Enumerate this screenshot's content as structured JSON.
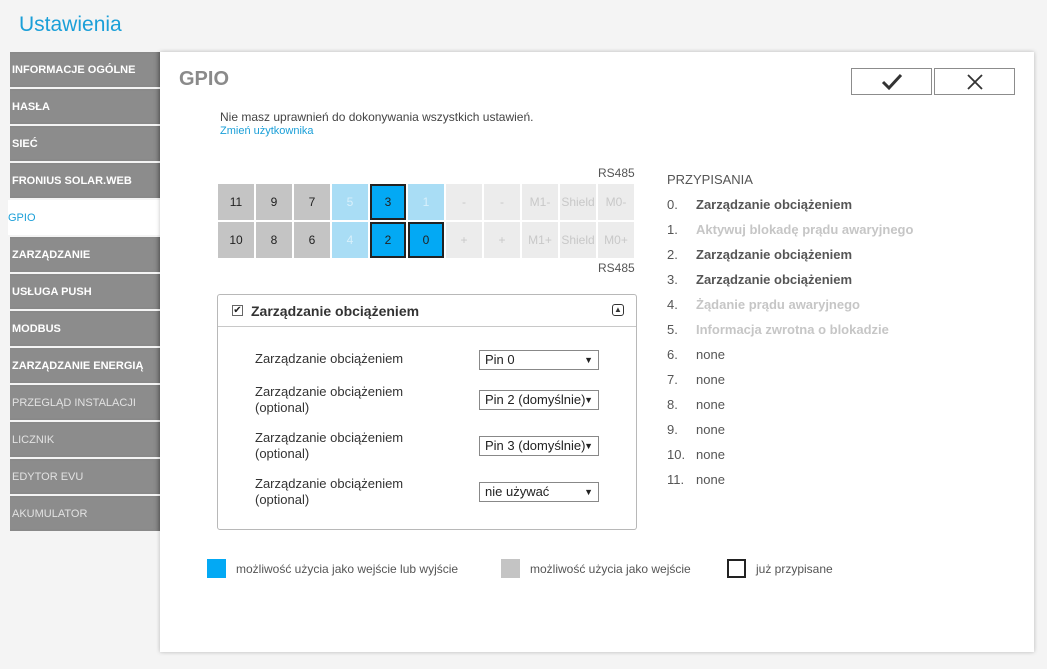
{
  "app_title": "Ustawienia",
  "sidebar": {
    "items": [
      {
        "label": "INFORMACJE OGÓLNE"
      },
      {
        "label": "HASŁA"
      },
      {
        "label": "SIEĆ"
      },
      {
        "label": "FRONIUS SOLAR.WEB"
      },
      {
        "label": "GPIO"
      },
      {
        "label": "ZARZĄDZANIE"
      },
      {
        "label": "USŁUGA PUSH"
      },
      {
        "label": "MODBUS"
      },
      {
        "label": "ZARZĄDZANIE ENERGIĄ"
      },
      {
        "label": "PRZEGLĄD INSTALACJI"
      },
      {
        "label": "LICZNIK"
      },
      {
        "label": "EDYTOR EVU"
      },
      {
        "label": "AKUMULATOR"
      }
    ]
  },
  "panel": {
    "title": "GPIO",
    "notice": "Nie masz uprawnień do dokonywania wszystkich ustawień.",
    "change_user_link": "Zmień użytkownika",
    "rs485_top": "RS485",
    "rs485_bottom": "RS485"
  },
  "pins": {
    "top_row": [
      {
        "label": "11",
        "state": "gray"
      },
      {
        "label": "9",
        "state": "gray"
      },
      {
        "label": "7",
        "state": "gray"
      },
      {
        "label": "5",
        "state": "lightblue"
      },
      {
        "label": "3",
        "state": "blue"
      },
      {
        "label": "1",
        "state": "lightblue"
      },
      {
        "label": "-",
        "state": "disabled"
      },
      {
        "label": "-",
        "state": "disabled"
      },
      {
        "label": "M1-",
        "state": "disabled"
      },
      {
        "label": "Shield",
        "state": "disabled"
      },
      {
        "label": "M0-",
        "state": "disabled"
      }
    ],
    "bottom_row": [
      {
        "label": "10",
        "state": "gray"
      },
      {
        "label": "8",
        "state": "gray"
      },
      {
        "label": "6",
        "state": "gray"
      },
      {
        "label": "4",
        "state": "lightblue"
      },
      {
        "label": "2",
        "state": "blue"
      },
      {
        "label": "0",
        "state": "blue"
      },
      {
        "label": "+",
        "state": "disabled"
      },
      {
        "label": "+",
        "state": "disabled"
      },
      {
        "label": "M1+",
        "state": "disabled"
      },
      {
        "label": "Shield",
        "state": "disabled"
      },
      {
        "label": "M0+",
        "state": "disabled"
      }
    ]
  },
  "load_box": {
    "title": "Zarządzanie obciążeniem",
    "checked": true,
    "rows": [
      {
        "label": "Zarządzanie obciążeniem",
        "value": "Pin 0"
      },
      {
        "label": "Zarządzanie obciążeniem (optional)",
        "value": "Pin 2 (domyślnie)"
      },
      {
        "label": "Zarządzanie obciążeniem (optional)",
        "value": "Pin 3 (domyślnie)"
      },
      {
        "label": "Zarządzanie obciążeniem (optional)",
        "value": "nie używać"
      }
    ]
  },
  "assignments": {
    "heading": "PRZYPISANIA",
    "items": [
      {
        "num": "0.",
        "text": "Zarządzanie obciążeniem",
        "style": "bold"
      },
      {
        "num": "1.",
        "text": "Aktywuj blokadę prądu awaryjnego",
        "style": "faded"
      },
      {
        "num": "2.",
        "text": "Zarządzanie obciążeniem",
        "style": "bold"
      },
      {
        "num": "3.",
        "text": "Zarządzanie obciążeniem",
        "style": "bold"
      },
      {
        "num": "4.",
        "text": "Żądanie prądu awaryjnego",
        "style": "faded"
      },
      {
        "num": "5.",
        "text": "Informacja zwrotna o blokadzie",
        "style": "faded"
      },
      {
        "num": "6.",
        "text": "none",
        "style": "none"
      },
      {
        "num": "7.",
        "text": "none",
        "style": "none"
      },
      {
        "num": "8.",
        "text": "none",
        "style": "none"
      },
      {
        "num": "9.",
        "text": "none",
        "style": "none"
      },
      {
        "num": "10.",
        "text": "none",
        "style": "none"
      },
      {
        "num": "11.",
        "text": "none",
        "style": "none"
      }
    ]
  },
  "legend": {
    "io": "możliwość użycia jako wejście lub wyjście",
    "input": "możliwość użycia jako wejście",
    "assigned": "już przypisane"
  },
  "colors": {
    "accent": "#1a9fd8",
    "io": "#03a9f4",
    "input": "#c4c4c4",
    "assigned_border": "#222222"
  }
}
